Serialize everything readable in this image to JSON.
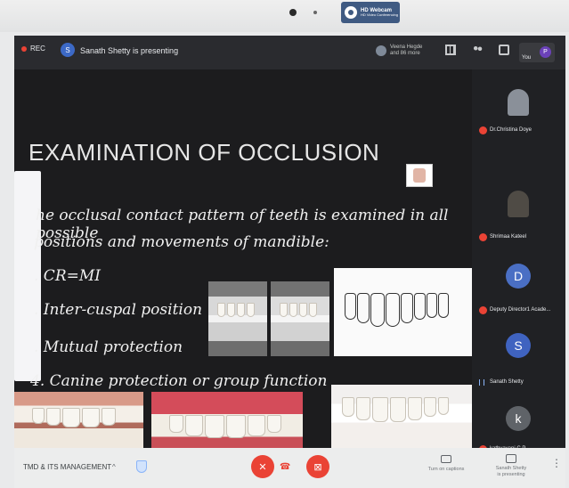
{
  "bezel": {
    "webcam_title": "HD Webcam",
    "webcam_subtitle": "HD Video Conferencing"
  },
  "topbar": {
    "rec_label": "REC",
    "presenter_initial": "S",
    "presenter_text": "Sanath Shetty is presenting",
    "participants_line1": "Veena Hegde",
    "participants_line2": "and 86 more",
    "you_label": "You",
    "you_initial": "P"
  },
  "slide": {
    "title": "EXAMINATION OF OCCLUSION",
    "line1": "he occlusal contact pattern of teeth is examined in all possible",
    "line2": "positions and movements of mandible:",
    "item1": ". CR=MI",
    "item2": ". Inter-cuspal position",
    "item3": ". Mutual protection",
    "item4": "4. Canine protection or group function"
  },
  "sidebar": {
    "tiles": [
      {
        "name": "Dr.Christina Doye",
        "kind": "photo",
        "muted": true
      },
      {
        "name": "Shrimaa Kateel",
        "kind": "photo",
        "muted": true
      },
      {
        "name": "Deputy Director1 Acade...",
        "kind": "initial",
        "initial": "D",
        "color": "#4a6fc4",
        "muted": true
      },
      {
        "name": "Sanath Shetty",
        "kind": "initial",
        "initial": "S",
        "color": "#3f63c0",
        "muted": false
      },
      {
        "name": "kathyayani C.P",
        "kind": "initial",
        "initial": "k",
        "color": "#5f6368",
        "muted": true
      }
    ]
  },
  "bottombar": {
    "meeting_title": "TMD & ITS MANAGEMENT",
    "chevron": "^",
    "captions_label": "Turn on captions",
    "present_line1": "Sanath Shetty",
    "present_line2": "is presenting",
    "more": "⋮"
  },
  "colors": {
    "meet_bg": "#202124",
    "red": "#ea4335",
    "bottombar": "#eceded"
  },
  "icons": [
    "camera-icon",
    "grid-icon",
    "people-icon",
    "chat-icon",
    "shield-icon",
    "mic-off-icon",
    "hangup-icon",
    "camera-off-icon",
    "captions-icon",
    "present-icon",
    "more-icon"
  ]
}
